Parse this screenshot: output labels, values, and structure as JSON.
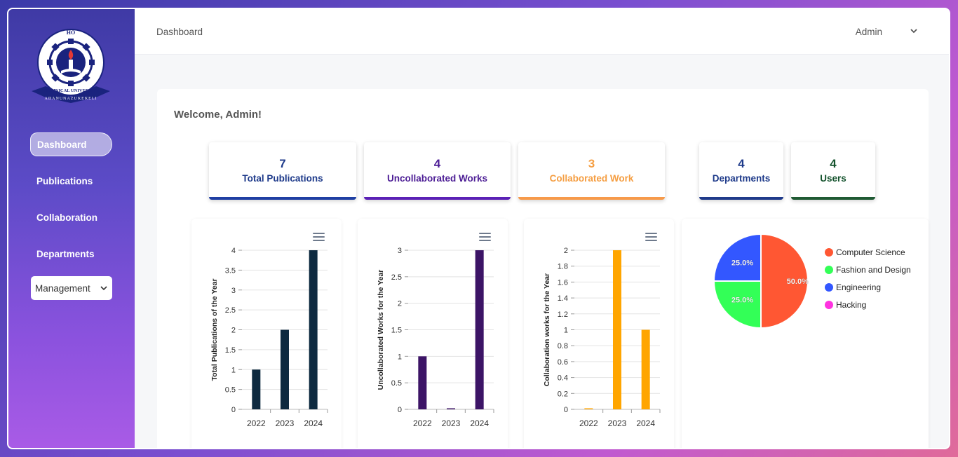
{
  "sidebar": {
    "logo_text_top": "HO",
    "logo_text_ring": "TECHNICAL UNIVERSITY",
    "logo_text_ribbon": "ADANUNAZUKEKELI",
    "items": [
      {
        "label": "Dashboard",
        "active": true
      },
      {
        "label": "Publications",
        "active": false
      },
      {
        "label": "Collaboration",
        "active": false
      },
      {
        "label": "Departments",
        "active": false
      }
    ],
    "management_select": "Management"
  },
  "topbar": {
    "breadcrumb": "Dashboard",
    "user": "Admin"
  },
  "main": {
    "welcome": "Welcome, Admin!",
    "stats": [
      {
        "value": "7",
        "label": "Total Publications",
        "color": "#1e3a8a",
        "underline": "#1f3fa3"
      },
      {
        "value": "4",
        "label": "Uncollaborated Works",
        "color": "#4c1d95",
        "underline": "#5b21b6"
      },
      {
        "value": "3",
        "label": "Collaborated Work",
        "color": "#f59e42",
        "underline": "#f79a4a"
      },
      {
        "value": "4",
        "label": "Departments",
        "color": "#1e3a8a",
        "underline": "#1f3a8a"
      },
      {
        "value": "4",
        "label": "Users",
        "color": "#14532d",
        "underline": "#1f5a33"
      }
    ]
  },
  "chart_data": [
    {
      "type": "bar",
      "categories": [
        "2022",
        "2023",
        "2024"
      ],
      "values": [
        1,
        2,
        4
      ],
      "ylabel": "Total Publications of the Year",
      "ylim": [
        0,
        4
      ],
      "yticks": [
        0,
        0.5,
        1,
        1.5,
        2,
        2.5,
        3,
        3.5,
        4
      ],
      "color": "#0e2a40"
    },
    {
      "type": "bar",
      "categories": [
        "2022",
        "2023",
        "2024"
      ],
      "values": [
        1,
        0,
        3
      ],
      "ylabel": "Uncollaborated Works for the Year",
      "ylim": [
        0,
        3
      ],
      "yticks": [
        0,
        0.5,
        1,
        1.5,
        2,
        2.5,
        3
      ],
      "color": "#3c1466"
    },
    {
      "type": "bar",
      "categories": [
        "2022",
        "2023",
        "2024"
      ],
      "values": [
        0,
        2,
        1
      ],
      "ylabel": "Collaboration works for the Year",
      "ylim": [
        0,
        2
      ],
      "yticks": [
        0,
        0.2,
        0.4,
        0.6,
        0.8,
        1,
        1.2,
        1.4,
        1.6,
        1.8,
        2
      ],
      "color": "#ffa500"
    },
    {
      "type": "pie",
      "labels": [
        "Computer Science",
        "Fashion and Design",
        "Engineering",
        "Hacking"
      ],
      "values": [
        50,
        25,
        25,
        0
      ],
      "colors": [
        "#ff5733",
        "#33ff57",
        "#3357ff",
        "#ff33e0"
      ],
      "slice_labels": [
        "50.0%",
        "25.0%",
        "25.0%",
        ""
      ]
    }
  ]
}
